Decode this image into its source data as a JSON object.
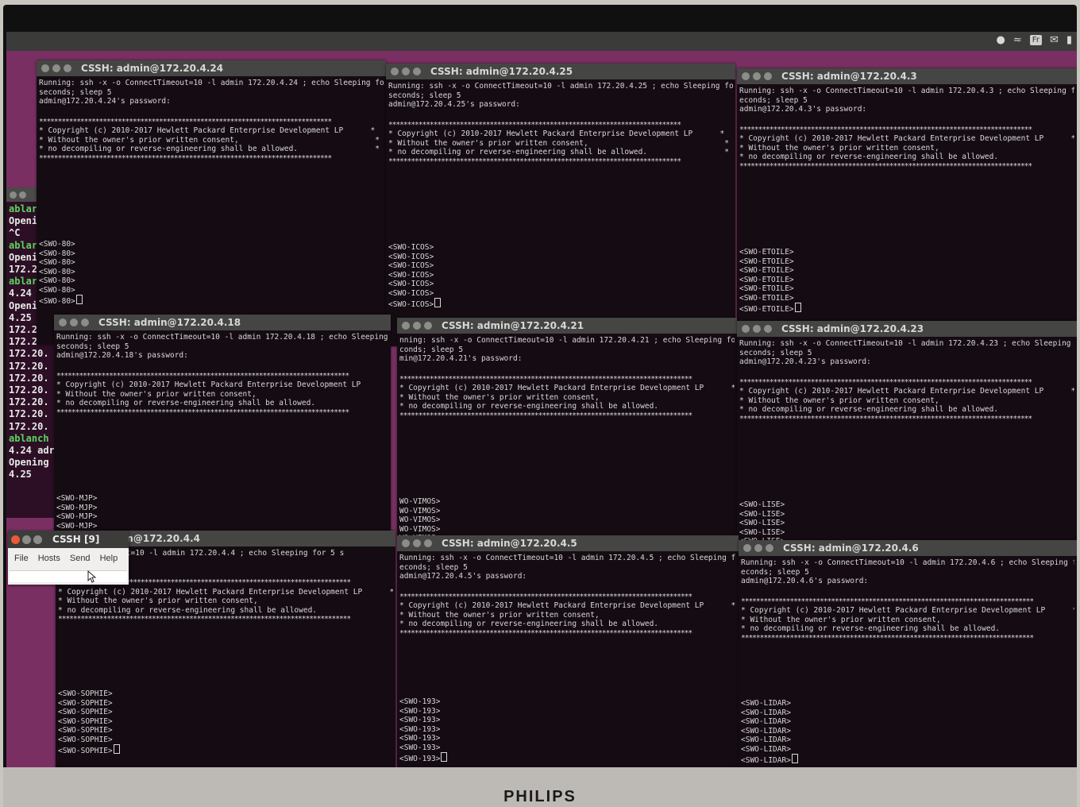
{
  "tray": {
    "fr_label": "Fr"
  },
  "monitor_brand": "PHILIPS",
  "background_terminal": {
    "lines": [
      "ablar",
      "Openi",
      "^C",
      "ablar",
      "Openi",
      "172.2",
      "ablar",
      "4.24",
      "Opening",
      "4.25",
      "172.20.",
      "172.20.",
      "172.20.",
      "172.20.",
      "172.20.",
      "172.20.",
      "172.20.",
      "172.20.",
      "172.20.",
      "ablanch",
      "4.24 adr",
      "Opening",
      "4.25"
    ]
  },
  "control_window": {
    "title": "CSSH [9]",
    "menu": [
      "File",
      "Hosts",
      "Send",
      "Help"
    ]
  },
  "banner": {
    "copyright": "* Copyright (c) 2010-2017 Hewlett Packard Enterprise Development LP      *",
    "consent": "* Without the owner's prior written consent,                              *",
    "noreverse": "* no decompiling or reverse-engineering shall be allowed.                 *"
  },
  "terminals": [
    {
      "title": "CSSH: admin@172.20.4.24",
      "running": "Running: ssh -x -o ConnectTimeout=10 -l admin 172.20.4.24 ; echo Sleeping for 5",
      "sleep": "seconds; sleep 5",
      "password": "admin@172.20.4.24's password:",
      "prompt": "<SWO-80>"
    },
    {
      "title": "CSSH: admin@172.20.4.25",
      "running": "Running: ssh -x -o ConnectTimeout=10 -l admin 172.20.4.25 ; echo Sleeping for 5",
      "sleep": "seconds; sleep 5",
      "password": "admin@172.20.4.25's password:",
      "prompt": "<SWO-ICOS>"
    },
    {
      "title": "CSSH: admin@172.20.4.3",
      "running": "Running: ssh -x -o ConnectTimeout=10 -l admin 172.20.4.3 ; echo Sleeping for 5 s",
      "sleep": "econds; sleep 5",
      "password": "admin@172.20.4.3's password:",
      "prompt": "<SWO-ETOILE>"
    },
    {
      "title": "CSSH: admin@172.20.4.18",
      "running": "Running: ssh -x -o ConnectTimeout=10 -l admin 172.20.4.18 ; echo Sleeping for 5",
      "sleep": "seconds; sleep 5",
      "password": "admin@172.20.4.18's password:",
      "prompt": "<SWO-MJP>"
    },
    {
      "title": "CSSH: admin@172.20.4.21",
      "running": "nning: ssh -x -o ConnectTimeout=10 -l admin 172.20.4.21 ; echo Sleeping for 5",
      "sleep": "conds; sleep 5",
      "password": "min@172.20.4.21's password:",
      "prompt": "WO-VIMOS>"
    },
    {
      "title": "CSSH: admin@172.20.4.23",
      "running": "Running: ssh -x -o ConnectTimeout=10 -l admin 172.20.4.23 ; echo Sleeping for 5",
      "sleep": "seconds; sleep 5",
      "password": "admin@172.20.4.23's password:",
      "prompt": "<SWO-LISE>"
    },
    {
      "title": "admin@172.20.4.4",
      "running": "o ConnectTimeout=10 -l admin 172.20.4.4 ; echo Sleeping for 5 s",
      "sleep": "",
      "password": " password:",
      "prompt": "<SWO-SOPHIE>"
    },
    {
      "title": "CSSH: admin@172.20.4.5",
      "running": "Running: ssh -x -o ConnectTimeout=10 -l admin 172.20.4.5 ; echo Sleeping for 5 s",
      "sleep": "econds; sleep 5",
      "password": "admin@172.20.4.5's password:",
      "prompt": "<SWO-193>"
    },
    {
      "title": "CSSH: admin@172.20.4.6",
      "running": "Running: ssh -x -o ConnectTimeout=10 -l admin 172.20.4.6 ; echo Sleeping for 5 s",
      "sleep": "econds; sleep 5",
      "password": "admin@172.20.4.6's password:",
      "prompt": "<SWO-LIDAR>"
    }
  ]
}
